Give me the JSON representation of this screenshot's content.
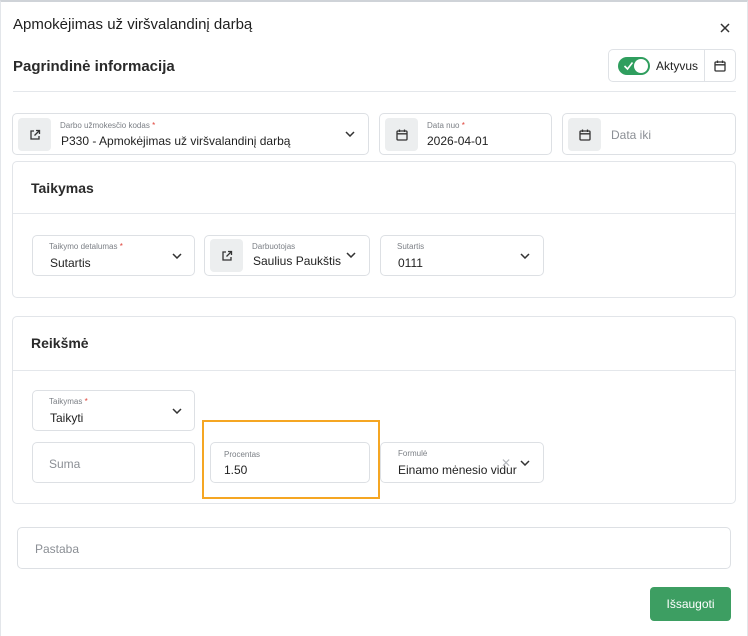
{
  "dialog": {
    "title": "Apmokėjimas už viršvalandinį darbą",
    "section_title": "Pagrindinė informacija",
    "active_toggle_label": "Aktyvus",
    "active": true
  },
  "main": {
    "code_field": {
      "label": "Darbo užmokesčio kodas",
      "required": "*",
      "value": "P330 - Apmokėjimas už viršvalandinį darbą"
    },
    "date_from": {
      "label": "Data nuo",
      "required": "*",
      "value": "2026-04-01"
    },
    "date_to": {
      "placeholder": "Data iki"
    }
  },
  "taikymas_card": {
    "title": "Taikymas",
    "detail_field": {
      "label": "Taikymo detalumas",
      "required": "*",
      "value": "Sutartis"
    },
    "employee_field": {
      "label": "Darbuotojas",
      "value": "Saulius Paukštis"
    },
    "contract_field": {
      "label": "Sutartis",
      "value": "0111"
    }
  },
  "reiksme_card": {
    "title": "Reikšmė",
    "apply_field": {
      "label": "Taikymas",
      "required": "*",
      "value": "Taikyti"
    },
    "amount_field": {
      "placeholder": "Suma"
    },
    "percent_field": {
      "label": "Procentas",
      "value": "1.50"
    },
    "formula_field": {
      "label": "Formulė",
      "value": "Einamo mėnesio vidur"
    }
  },
  "note": {
    "placeholder": "Pastaba"
  },
  "actions": {
    "save_label": "Išsaugoti"
  },
  "colors": {
    "accent_green": "#3d9e62",
    "highlight_orange": "#f5a623",
    "required_red": "#e0443b"
  }
}
